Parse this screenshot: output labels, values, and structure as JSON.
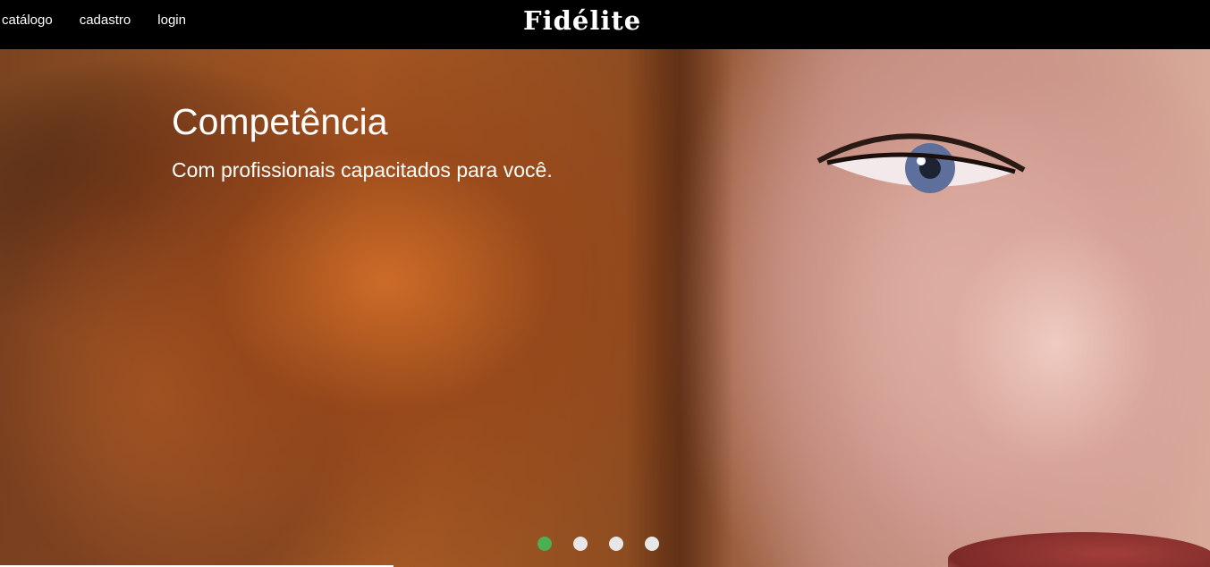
{
  "nav": {
    "links": [
      "catálogo",
      "cadastro",
      "login"
    ],
    "brand": "Fidélite"
  },
  "slider": {
    "title": "Competência",
    "subtitle": "Com profissionais capacitados para você.",
    "indicators": 4,
    "active_index": 0,
    "active_color": "#4caf50",
    "inactive_color": "#e7e7e7"
  }
}
